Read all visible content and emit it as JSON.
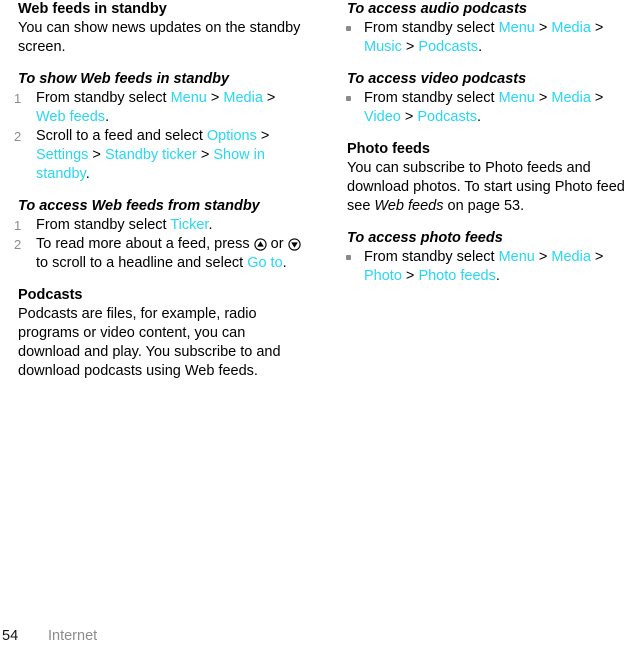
{
  "colors": {
    "link": "#28D7F2",
    "step_number": "#8C8C8C",
    "bullet": "#8A8A8A",
    "footer_section": "#8C8C8C",
    "text": "#000000"
  },
  "left_column": {
    "section_heading": "Web feeds in standby",
    "section_intro": "You can show news updates on the standby screen.",
    "task1": {
      "heading": "To show Web feeds in standby",
      "steps": [
        {
          "number": "1",
          "parts": [
            {
              "type": "text",
              "value": "From standby select "
            },
            {
              "type": "link",
              "value": "Menu"
            },
            {
              "type": "sep",
              "value": " > "
            },
            {
              "type": "link",
              "value": "Media"
            },
            {
              "type": "sep",
              "value": " > "
            },
            {
              "type": "link",
              "value": "Web feeds"
            },
            {
              "type": "text",
              "value": "."
            }
          ]
        },
        {
          "number": "2",
          "parts": [
            {
              "type": "text",
              "value": "Scroll to a feed and select "
            },
            {
              "type": "link",
              "value": "Options"
            },
            {
              "type": "sep",
              "value": " > "
            },
            {
              "type": "link",
              "value": "Settings"
            },
            {
              "type": "sep",
              "value": " > "
            },
            {
              "type": "link",
              "value": "Standby ticker"
            },
            {
              "type": "sep",
              "value": " > "
            },
            {
              "type": "link",
              "value": "Show in standby"
            },
            {
              "type": "text",
              "value": "."
            }
          ]
        }
      ]
    },
    "task2": {
      "heading": "To access Web feeds from standby",
      "steps": [
        {
          "number": "1",
          "parts": [
            {
              "type": "text",
              "value": "From standby select "
            },
            {
              "type": "link",
              "value": "Ticker"
            },
            {
              "type": "text",
              "value": "."
            }
          ]
        },
        {
          "number": "2",
          "parts": [
            {
              "type": "text",
              "value": "To read more about a feed, press "
            },
            {
              "type": "icon",
              "value": "nav-key-up-icon"
            },
            {
              "type": "text",
              "value": " or "
            },
            {
              "type": "icon",
              "value": "nav-key-down-icon"
            },
            {
              "type": "text",
              "value": " to scroll to a headline and select "
            },
            {
              "type": "link",
              "value": "Go to"
            },
            {
              "type": "text",
              "value": "."
            }
          ]
        }
      ]
    },
    "podcasts": {
      "heading": "Podcasts",
      "body": "Podcasts are files, for example, radio programs or video content, you can download and play. You subscribe to and download podcasts using Web feeds."
    }
  },
  "right_column": {
    "task_audio": {
      "heading": "To access audio podcasts",
      "items": [
        {
          "parts": [
            {
              "type": "text",
              "value": "From standby select "
            },
            {
              "type": "link",
              "value": "Menu"
            },
            {
              "type": "sep",
              "value": " > "
            },
            {
              "type": "link",
              "value": "Media"
            },
            {
              "type": "sep",
              "value": " > "
            },
            {
              "type": "link",
              "value": "Music"
            },
            {
              "type": "sep",
              "value": " > "
            },
            {
              "type": "link",
              "value": "Podcasts"
            },
            {
              "type": "text",
              "value": "."
            }
          ]
        }
      ]
    },
    "task_video": {
      "heading": "To access video podcasts",
      "items": [
        {
          "parts": [
            {
              "type": "text",
              "value": "From standby select "
            },
            {
              "type": "link",
              "value": "Menu"
            },
            {
              "type": "sep",
              "value": " > "
            },
            {
              "type": "link",
              "value": "Media"
            },
            {
              "type": "sep",
              "value": " > "
            },
            {
              "type": "link",
              "value": "Video"
            },
            {
              "type": "sep",
              "value": " > "
            },
            {
              "type": "link",
              "value": "Podcasts"
            },
            {
              "type": "text",
              "value": "."
            }
          ]
        }
      ]
    },
    "photo_feeds": {
      "heading": "Photo feeds",
      "body_parts": [
        {
          "type": "text",
          "value": "You can subscribe to Photo feeds and download photos. To start using Photo feeds, see "
        },
        {
          "type": "italic",
          "value": "Web feeds"
        },
        {
          "type": "text",
          "value": " on page 53."
        }
      ]
    },
    "task_photo": {
      "heading": "To access photo feeds",
      "items": [
        {
          "parts": [
            {
              "type": "text",
              "value": "From standby select "
            },
            {
              "type": "link",
              "value": "Menu"
            },
            {
              "type": "sep",
              "value": " > "
            },
            {
              "type": "link",
              "value": "Media"
            },
            {
              "type": "sep",
              "value": " > "
            },
            {
              "type": "link",
              "value": "Photo"
            },
            {
              "type": "sep",
              "value": " > "
            },
            {
              "type": "link",
              "value": "Photo feeds"
            },
            {
              "type": "text",
              "value": "."
            }
          ]
        }
      ]
    }
  },
  "footer": {
    "page_number": "54",
    "section": "Internet"
  }
}
